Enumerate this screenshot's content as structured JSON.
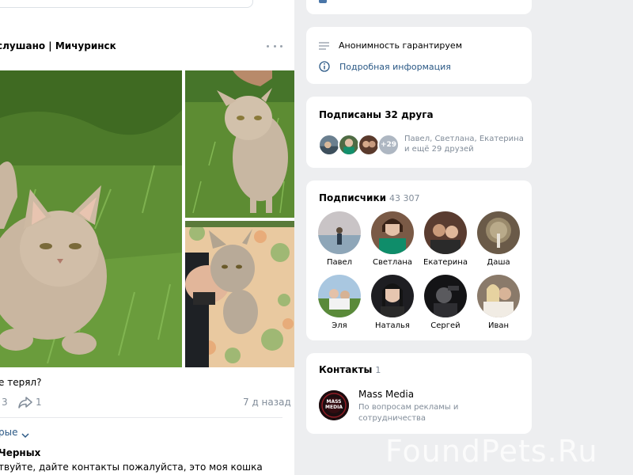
{
  "post": {
    "title": "слушано | Мичуринск",
    "text": "е терял?",
    "likes_count": "3",
    "shares_count": "1",
    "date": "7 д назад",
    "comments_sort": "рые",
    "comment": {
      "author": "Черных",
      "text": "твуйте, дайте контакты пожалуйста, это моя кошка"
    }
  },
  "sidebar": {
    "info": {
      "anonymity": "Анонимность гарантируем",
      "details_link": "Подробная информация"
    },
    "friends": {
      "title": "Подписаны 32 друга",
      "more_badge": "+29",
      "desc_line1": "Павел, Светлана, Екатерина",
      "desc_line2": "и ещё 29 друзей"
    },
    "followers": {
      "title": "Подписчики",
      "count": "43 307",
      "people": [
        {
          "name": "Павел"
        },
        {
          "name": "Светлана"
        },
        {
          "name": "Екатерина"
        },
        {
          "name": "Даша"
        },
        {
          "name": "Эля"
        },
        {
          "name": "Наталья"
        },
        {
          "name": "Сергей"
        },
        {
          "name": "Иван"
        }
      ]
    },
    "contacts": {
      "title": "Контакты",
      "count": "1",
      "name": "Mass Media",
      "role": "По вопросам рекламы и сотрудничества",
      "logo_text": "MASS MEDIA"
    }
  },
  "watermark": "FoundPets.Ru",
  "colors": {
    "link": "#2a5885",
    "muted": "#818c99",
    "background": "#edeef0",
    "card": "#ffffff"
  },
  "icons": [
    "more-icon",
    "share-icon",
    "chevron-down-icon",
    "lines-icon",
    "info-icon"
  ]
}
